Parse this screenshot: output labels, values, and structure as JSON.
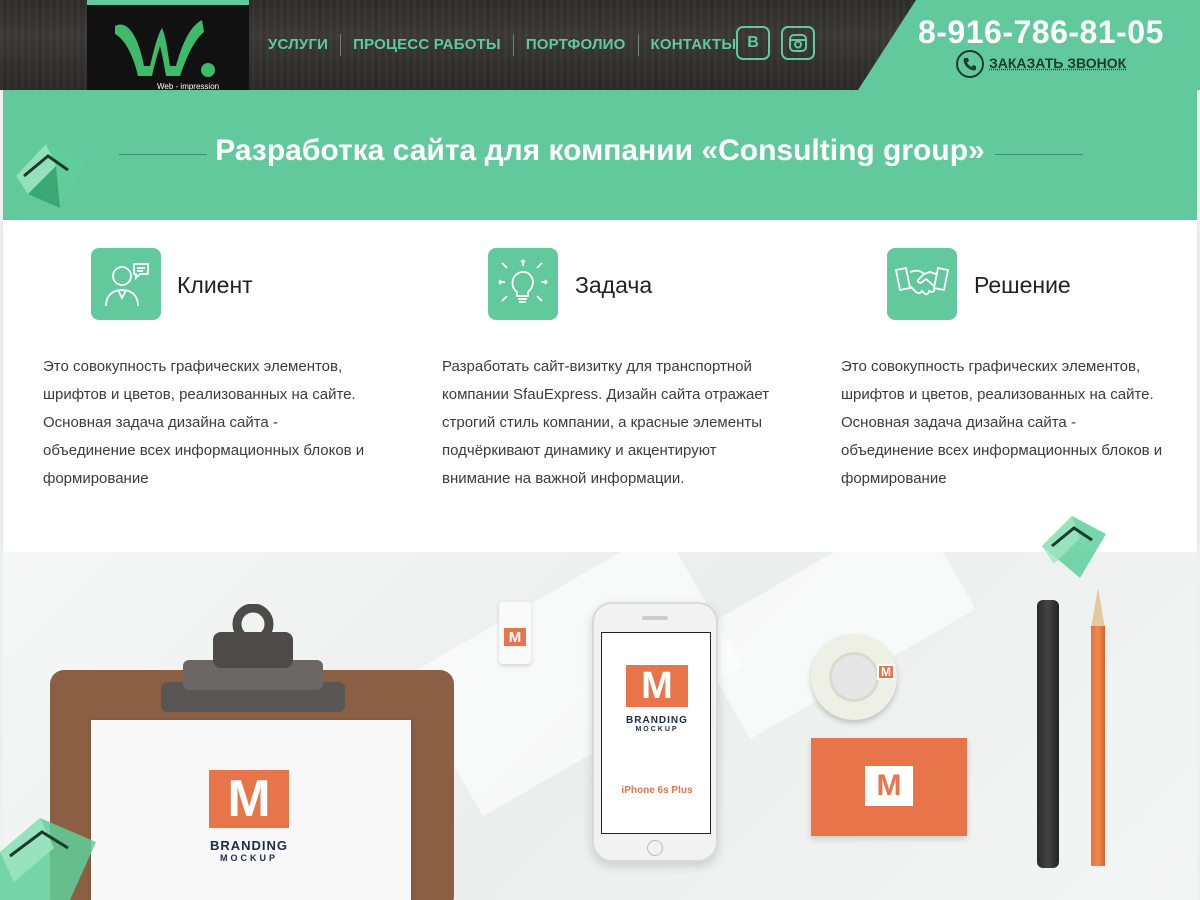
{
  "header": {
    "logo_text": "Web - impression",
    "nav": [
      "УСЛУГИ",
      "ПРОЦЕСС РАБОТЫ",
      "ПОРТФОЛИО",
      "КОНТАКТЫ"
    ],
    "social": {
      "vk": "В"
    },
    "phone": "8-916-786-81-05",
    "callback_label": "ЗАКАЗАТЬ ЗВОНОК"
  },
  "banner": {
    "title": "Разработка сайта для компании «Consulting group»"
  },
  "features": [
    {
      "icon": "client-icon",
      "title": "Клиент",
      "text": "Это совокупность графических элементов, шрифтов и цветов, реализованных на сайте. Основная задача дизайна сайта - объединение всех информационных блоков и формирование"
    },
    {
      "icon": "idea-icon",
      "title": "Задача",
      "text": "Разработать сайт-визитку для транспортной компании SfauExpress. Дизайн сайта отражает строгий стиль компании, а красные элементы подчёркивают динамику и акцентируют внимание на важной информации."
    },
    {
      "icon": "handshake-icon",
      "title": "Решение",
      "text": "Это совокупность графических элементов, шрифтов и цветов, реализованных на сайте. Основная задача дизайна сайта - объединение всех информационных блоков и формирование"
    }
  ],
  "mockup": {
    "brand_line1": "BRANDING",
    "brand_line2": "MOCKUP",
    "logo_letter": "M",
    "phone_label": "iPhone 6s Plus"
  },
  "colors": {
    "accent": "#62c99c",
    "brand_orange": "#e8744a",
    "brand_navy": "#1e2a4c"
  }
}
